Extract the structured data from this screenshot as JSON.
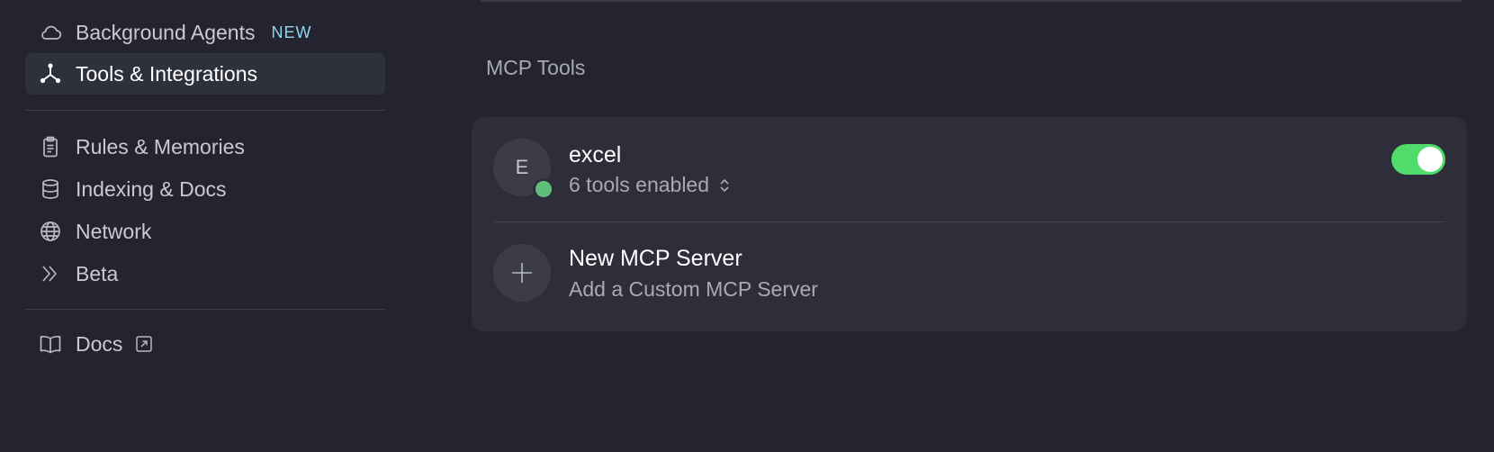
{
  "sidebar": {
    "items": [
      {
        "label": "Background Agents",
        "icon": "cloud-icon",
        "badge": "NEW"
      },
      {
        "label": "Tools & Integrations",
        "icon": "integrations-icon",
        "active": true
      },
      {
        "label": "Rules & Memories",
        "icon": "clipboard-icon"
      },
      {
        "label": "Indexing & Docs",
        "icon": "database-icon"
      },
      {
        "label": "Network",
        "icon": "globe-icon"
      },
      {
        "label": "Beta",
        "icon": "double-chevron-icon"
      },
      {
        "label": "Docs",
        "icon": "book-icon",
        "external": true
      }
    ]
  },
  "main": {
    "section_title": "MCP Tools",
    "servers": [
      {
        "avatar_letter": "E",
        "name": "excel",
        "subtitle": "6 tools enabled",
        "enabled": true,
        "status_color": "#5fbf7a"
      }
    ],
    "new_server": {
      "title": "New MCP Server",
      "subtitle": "Add a Custom MCP Server"
    }
  },
  "colors": {
    "background": "#232430",
    "card": "#2d2e39",
    "toggle_on": "#4fdc6a",
    "badge": "#8fd6f0"
  }
}
